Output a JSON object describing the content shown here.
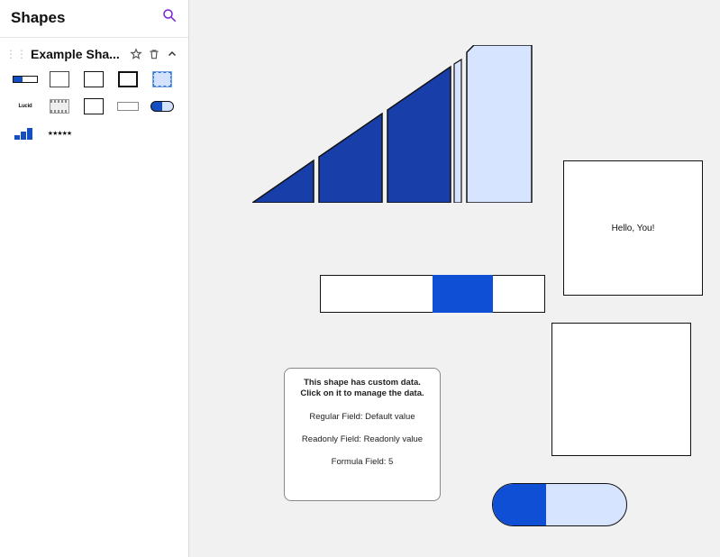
{
  "sidebar": {
    "title": "Shapes",
    "library_name": "Example Sha...",
    "thumbs": [
      "progress-bar",
      "rect-thin",
      "rect",
      "rect-heavy",
      "rect-selected",
      "lucid-logo",
      "film",
      "rect",
      "rect-flat",
      "pill",
      "staircase",
      "stars"
    ]
  },
  "canvas": {
    "hello_text": "Hello, You!",
    "data_shape": {
      "header_line1": "This shape has custom data.",
      "header_line2": "Click on it to manage the data.",
      "rows": [
        "Regular Field: Default value",
        "Readonly Field: Readonly value",
        "Formula Field: 5"
      ]
    },
    "staircase_fill": "#183fa9",
    "staircase_light": "#d6e4ff",
    "progress_fill": "#0f4fd6",
    "pill_fill": "#0f4fd6",
    "pill_bg": "#d6e4ff"
  }
}
